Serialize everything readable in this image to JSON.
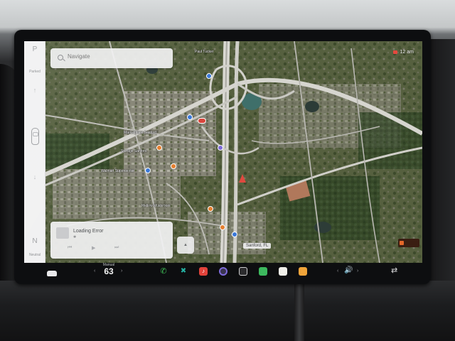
{
  "gear_selector": {
    "park": "P",
    "parked_label": "Parked",
    "neutral": "N",
    "neutral_label": "Neutral"
  },
  "search": {
    "placeholder": "Navigate",
    "icon": "search-icon"
  },
  "status": {
    "time": "12 am"
  },
  "map": {
    "labels": [
      "Paul Tucker",
      "Marketplace Sanford",
      "Storage Sanford",
      "Walmart Supercenter",
      "Mellow Mushroom",
      "Sanford, FL"
    ],
    "current_location": "Sanford, FL",
    "colors": {
      "nav_arrow": "#e0493f",
      "poi_blue": "#3a78d8",
      "poi_orange": "#e57f2f",
      "poi_red": "#d9453c"
    }
  },
  "media": {
    "title": "Loading Error",
    "source_icon": "bluetooth-icon",
    "controls": [
      "prev-icon",
      "play-icon",
      "next-icon"
    ]
  },
  "dock": {
    "temp_label": "Manual",
    "temperature": "63",
    "apps": [
      {
        "name": "phone-icon",
        "color": "#3fbf57"
      },
      {
        "name": "toybox-icon",
        "color": "#25b3a3"
      },
      {
        "name": "music-icon",
        "color": "#e2433b"
      },
      {
        "name": "camera-icon",
        "color": "#7d6ad8"
      },
      {
        "name": "app-launcher-icon",
        "color": "#e8e8ea"
      },
      {
        "name": "calendar-icon",
        "color": "#3db95e"
      },
      {
        "name": "notes-icon",
        "color": "#f0efe9"
      },
      {
        "name": "energy-icon",
        "color": "#f0a43a"
      }
    ],
    "volume_icon": "speaker-icon"
  }
}
